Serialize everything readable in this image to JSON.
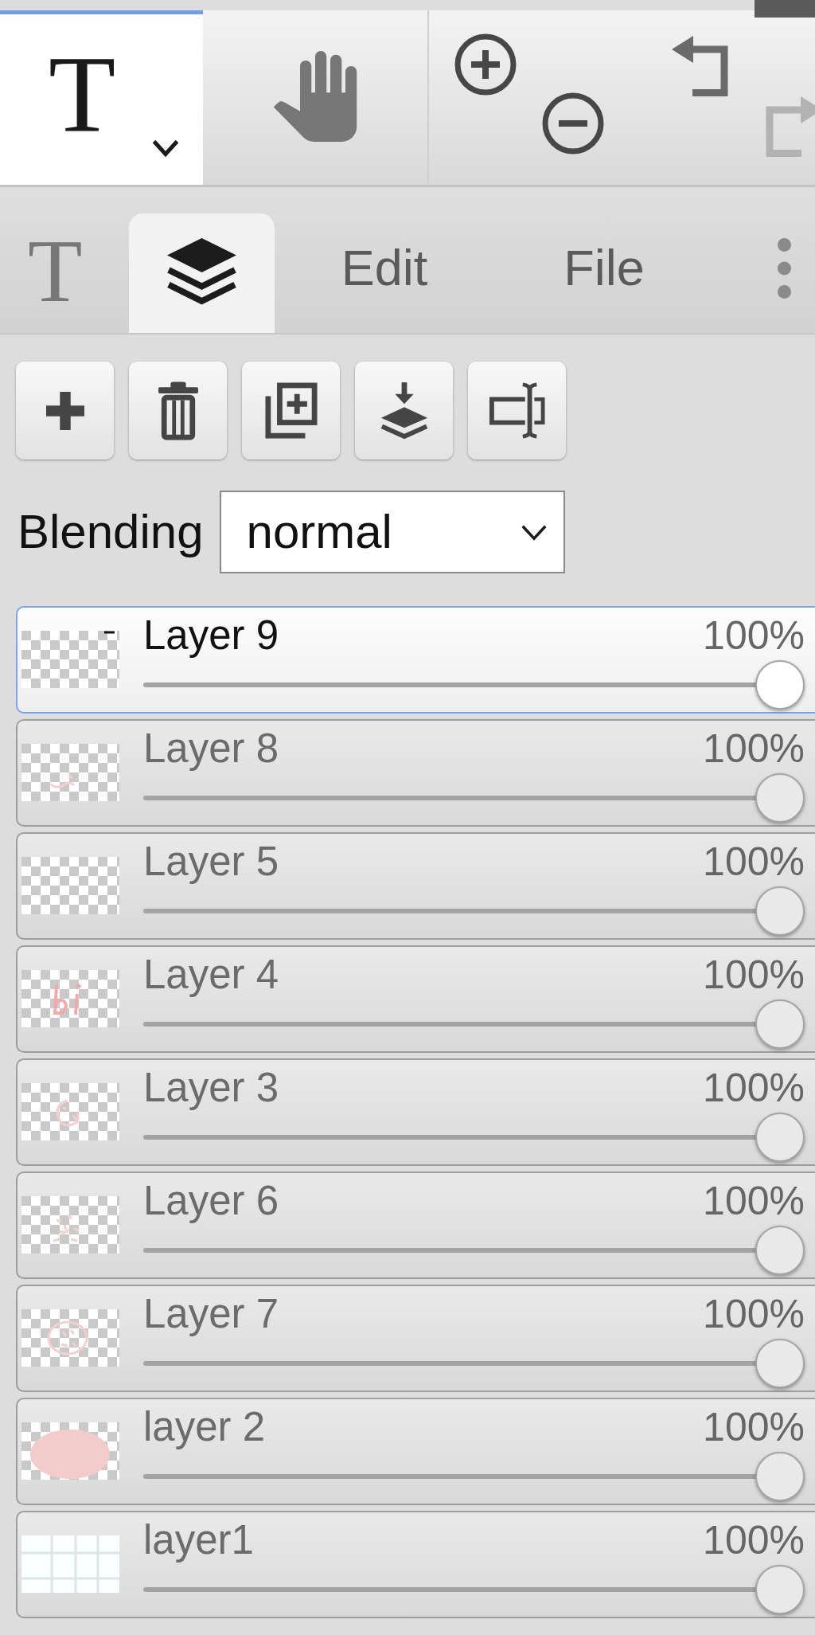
{
  "toolbar": {
    "tools": [
      {
        "kind": "text",
        "glyph": "T",
        "selected": true,
        "dropdown": true
      },
      {
        "kind": "pan",
        "selected": false,
        "dropdown": false
      }
    ],
    "history": [
      {
        "kind": "undo",
        "disabled": false
      },
      {
        "kind": "redo",
        "disabled": true
      }
    ]
  },
  "tabs": [
    {
      "kind": "glyph",
      "label": "T",
      "selected": false
    },
    {
      "kind": "layers",
      "selected": true
    },
    {
      "kind": "text",
      "label": "Edit",
      "selected": false
    },
    {
      "kind": "text",
      "label": "File",
      "selected": false
    }
  ],
  "layer_actions": [
    {
      "kind": "plus"
    },
    {
      "kind": "trash"
    },
    {
      "kind": "copy"
    },
    {
      "kind": "merge"
    },
    {
      "kind": "textbox"
    }
  ],
  "blending": {
    "label": "Blending",
    "value": "normal"
  },
  "layers": [
    {
      "name": "Layer 9",
      "opacity": "100%",
      "level": 1,
      "selected": true,
      "thumbnail": {
        "kind": "dash"
      }
    },
    {
      "name": "Layer 8",
      "opacity": "100%",
      "level": 1,
      "selected": false,
      "thumbnail": {
        "kind": "sketch"
      }
    },
    {
      "name": "Layer 5",
      "opacity": "100%",
      "level": 1,
      "selected": false,
      "thumbnail": {
        "kind": "empty"
      }
    },
    {
      "name": "Layer 4",
      "opacity": "100%",
      "level": 1,
      "selected": false,
      "thumbnail": {
        "kind": "sketch"
      }
    },
    {
      "name": "Layer 3",
      "opacity": "100%",
      "level": 1,
      "selected": false,
      "thumbnail": {
        "kind": "sketch"
      }
    },
    {
      "name": "Layer 6",
      "opacity": "100%",
      "level": 1,
      "selected": false,
      "thumbnail": {
        "kind": "sketch"
      }
    },
    {
      "name": "Layer 7",
      "opacity": "100%",
      "level": 1,
      "selected": false,
      "thumbnail": {
        "kind": "sketch"
      }
    },
    {
      "name": "layer 2",
      "opacity": "100%",
      "level": 1,
      "selected": false,
      "thumbnail": {
        "kind": "blob"
      }
    },
    {
      "name": "layer1",
      "opacity": "100%",
      "level": 1,
      "selected": false,
      "thumbnail": {
        "kind": "grid"
      }
    }
  ]
}
